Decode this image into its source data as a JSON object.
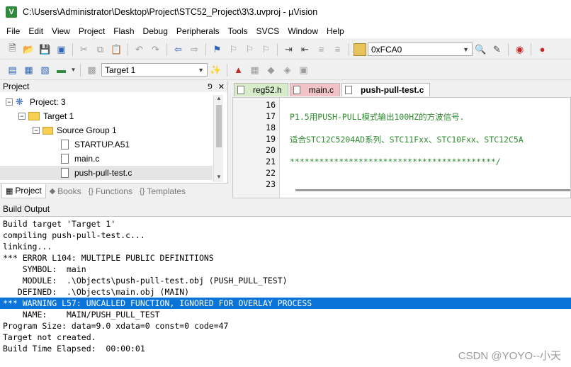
{
  "window": {
    "app_icon": "V",
    "title": "C:\\Users\\Administrator\\Desktop\\Project\\STC52_Project\\3\\3.uvproj - µVision"
  },
  "menu": [
    "File",
    "Edit",
    "View",
    "Project",
    "Flash",
    "Debug",
    "Peripherals",
    "Tools",
    "SVCS",
    "Window",
    "Help"
  ],
  "toolbar": {
    "address_value": "0xFCA0",
    "target_value": "Target 1"
  },
  "project_panel": {
    "title": "Project",
    "pin_icon": "pin-icon",
    "close_icon": "close-icon",
    "tree": {
      "project": "Project: 3",
      "target": "Target 1",
      "group": "Source Group 1",
      "files": [
        "STARTUP.A51",
        "main.c",
        "push-pull-test.c"
      ]
    },
    "tabs": [
      "Project",
      "Books",
      "Functions",
      "Templates"
    ]
  },
  "editor": {
    "tabs": [
      "reg52.h",
      "main.c",
      "push-pull-test.c"
    ],
    "lines": [
      {
        "num": "16",
        "text": ""
      },
      {
        "num": "17",
        "text": "P1.5用PUSH-PULL模式输出100HZ的方波信号."
      },
      {
        "num": "18",
        "text": ""
      },
      {
        "num": "19",
        "text": "适合STC12C5204AD系列、STC11Fxx、STC10Fxx、STC12C5A"
      },
      {
        "num": "20",
        "text": ""
      },
      {
        "num": "21",
        "text": "******************************************/"
      },
      {
        "num": "22",
        "text": ""
      },
      {
        "num": "23",
        "text": ""
      }
    ]
  },
  "build_output": {
    "title": "Build Output",
    "lines": [
      {
        "text": "Build target 'Target 1'",
        "highlight": false
      },
      {
        "text": "compiling push-pull-test.c...",
        "highlight": false
      },
      {
        "text": "linking...",
        "highlight": false
      },
      {
        "text": "*** ERROR L104: MULTIPLE PUBLIC DEFINITIONS",
        "highlight": false
      },
      {
        "text": "    SYMBOL:  main",
        "highlight": false
      },
      {
        "text": "    MODULE:  .\\Objects\\push-pull-test.obj (PUSH_PULL_TEST)",
        "highlight": false
      },
      {
        "text": "   DEFINED:  .\\Objects\\main.obj (MAIN)",
        "highlight": false
      },
      {
        "text": "*** WARNING L57: UNCALLED FUNCTION, IGNORED FOR OVERLAY PROCESS",
        "highlight": true
      },
      {
        "text": "    NAME:    MAIN/PUSH_PULL_TEST",
        "highlight": false
      },
      {
        "text": "Program Size: data=9.0 xdata=0 const=0 code=47",
        "highlight": false
      },
      {
        "text": "Target not created.",
        "highlight": false
      },
      {
        "text": "Build Time Elapsed:  00:00:01",
        "highlight": false
      }
    ]
  },
  "watermark": "CSDN @YOYO--小天",
  "colors": {
    "selection": "#0a74d8",
    "comment_green": "#2e8b2e",
    "tab_green": "#d7ecc9",
    "tab_pink": "#f2c3c6"
  }
}
